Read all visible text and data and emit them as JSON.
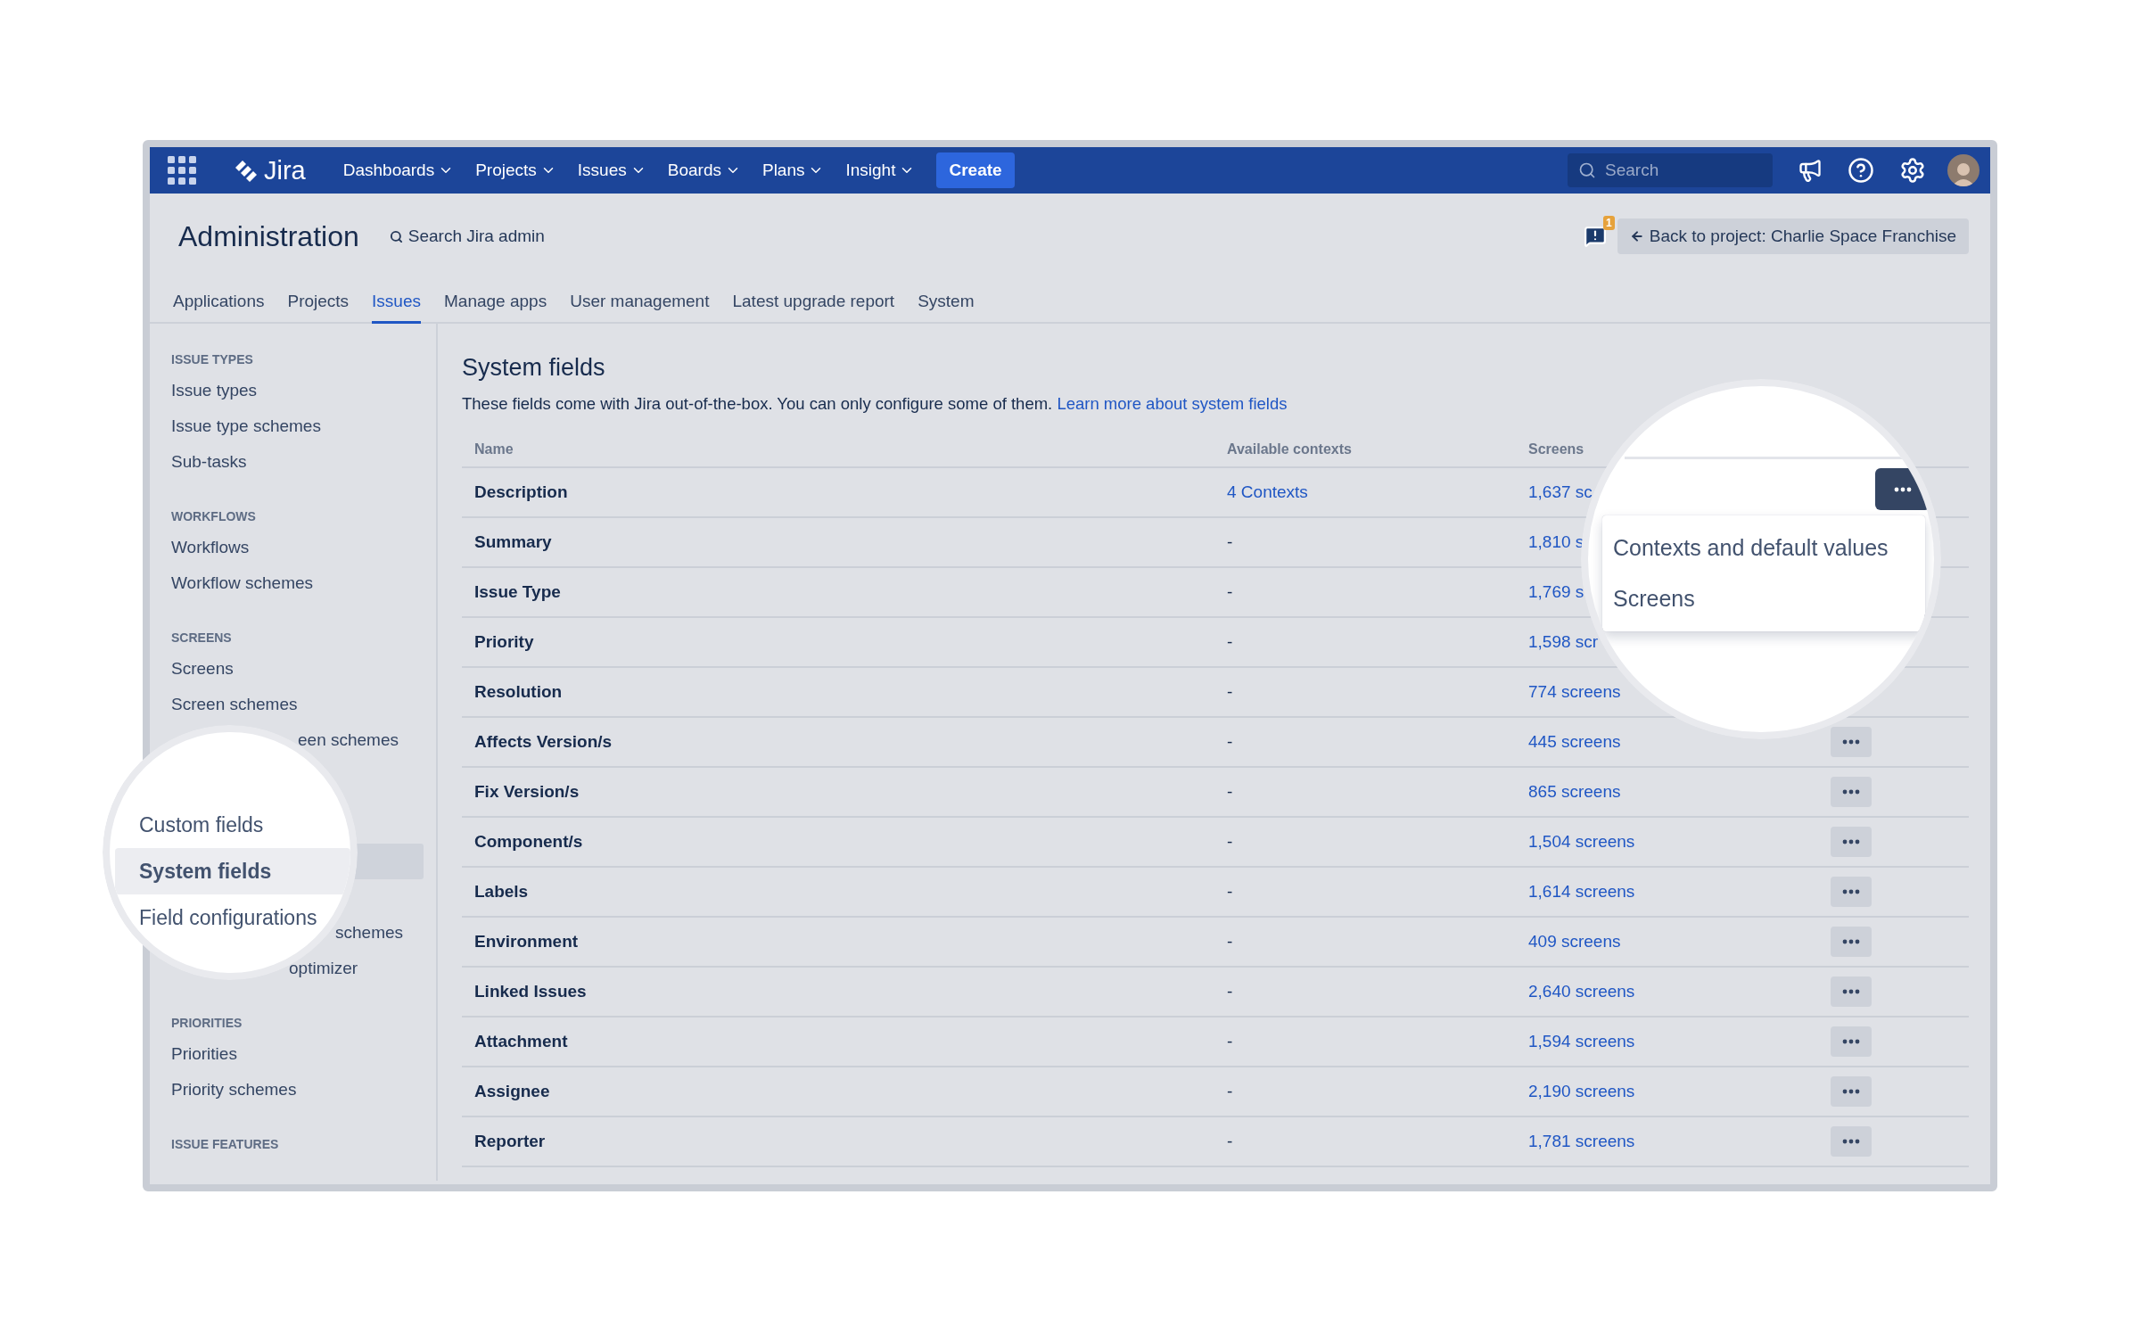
{
  "nav": {
    "logo": "Jira",
    "menus": [
      {
        "label": "Dashboards"
      },
      {
        "label": "Projects"
      },
      {
        "label": "Issues"
      },
      {
        "label": "Boards"
      },
      {
        "label": "Plans"
      },
      {
        "label": "Insight"
      }
    ],
    "create": "Create",
    "search": {
      "placeholder": "Search"
    }
  },
  "header": {
    "title": "Administration",
    "search_link": "Search Jira admin",
    "notification_badge": "1",
    "back_button": "Back to project: Charlie Space Franchise"
  },
  "tabs": [
    {
      "label": "Applications",
      "selected": false
    },
    {
      "label": "Projects",
      "selected": false
    },
    {
      "label": "Issues",
      "selected": true
    },
    {
      "label": "Manage apps",
      "selected": false
    },
    {
      "label": "User management",
      "selected": false
    },
    {
      "label": "Latest upgrade report",
      "selected": false
    },
    {
      "label": "System",
      "selected": false
    }
  ],
  "sidebar": {
    "groups": [
      {
        "kind": "plain",
        "heading": "ISSUE TYPES",
        "items": [
          {
            "label": "Issue types",
            "kind": "full"
          },
          {
            "label": "Issue type schemes",
            "kind": "full"
          },
          {
            "label": "Sub-tasks",
            "kind": "full"
          }
        ]
      },
      {
        "kind": "plain",
        "heading": "WORKFLOWS",
        "items": [
          {
            "label": "Workflows",
            "kind": "full"
          },
          {
            "label": "Workflow schemes",
            "kind": "full"
          }
        ]
      },
      {
        "kind": "plain",
        "heading": "SCREENS",
        "items": [
          {
            "label": "Screens",
            "kind": "full"
          },
          {
            "label": "Screen schemes",
            "kind": "full"
          },
          {
            "label": "een schemes",
            "kind": "partial"
          }
        ]
      },
      {
        "kind": "covered",
        "items": [
          {
            "label": "schemes",
            "kind": "partial"
          },
          {
            "label": "optimizer",
            "kind": "partial"
          }
        ]
      },
      {
        "kind": "plain",
        "heading": "PRIORITIES",
        "items": [
          {
            "label": "Priorities",
            "kind": "full"
          },
          {
            "label": "Priority schemes",
            "kind": "full"
          }
        ]
      },
      {
        "kind": "plain",
        "heading": "ISSUE FEATURES"
      }
    ]
  },
  "content": {
    "title": "System fields",
    "description": "These fields come with Jira out-of-the-box. You can only configure some of them.",
    "learn_more": "Learn more about system fields"
  },
  "table": {
    "columns": [
      "Name",
      "Available contexts",
      "Screens"
    ],
    "rows": [
      {
        "name": "Description",
        "contexts": "4 Contexts",
        "contexts_is_link": true,
        "screens": "1,637 sc",
        "has_menu": false
      },
      {
        "name": "Summary",
        "contexts": "-",
        "contexts_is_link": false,
        "screens": "1,810 s",
        "has_menu": false
      },
      {
        "name": "Issue Type",
        "contexts": "-",
        "contexts_is_link": false,
        "screens": "1,769 s",
        "has_menu": false
      },
      {
        "name": "Priority",
        "contexts": "-",
        "contexts_is_link": false,
        "screens": "1,598 scr",
        "has_menu": false
      },
      {
        "name": "Resolution",
        "contexts": "-",
        "contexts_is_link": false,
        "screens": "774 screens",
        "has_menu": false
      },
      {
        "name": "Affects Version/s",
        "contexts": "-",
        "contexts_is_link": false,
        "screens": "445 screens",
        "has_menu": true
      },
      {
        "name": "Fix Version/s",
        "contexts": "-",
        "contexts_is_link": false,
        "screens": "865 screens",
        "has_menu": true
      },
      {
        "name": "Component/s",
        "contexts": "-",
        "contexts_is_link": false,
        "screens": "1,504 screens",
        "has_menu": true
      },
      {
        "name": "Labels",
        "contexts": "-",
        "contexts_is_link": false,
        "screens": "1,614 screens",
        "has_menu": true
      },
      {
        "name": "Environment",
        "contexts": "-",
        "contexts_is_link": false,
        "screens": "409 screens",
        "has_menu": true
      },
      {
        "name": "Linked Issues",
        "contexts": "-",
        "contexts_is_link": false,
        "screens": "2,640 screens",
        "has_menu": true
      },
      {
        "name": "Attachment",
        "contexts": "-",
        "contexts_is_link": false,
        "screens": "1,594 screens",
        "has_menu": true
      },
      {
        "name": "Assignee",
        "contexts": "-",
        "contexts_is_link": false,
        "screens": "2,190 screens",
        "has_menu": true
      },
      {
        "name": "Reporter",
        "contexts": "-",
        "contexts_is_link": false,
        "screens": "1,781 screens",
        "has_menu": true
      }
    ]
  },
  "magnifier_left": {
    "items": [
      {
        "label": "Custom fields",
        "selected": false
      },
      {
        "label": "System fields",
        "selected": true
      },
      {
        "label": "Field configurations",
        "selected": false
      }
    ]
  },
  "magnifier_right": {
    "button_active": true,
    "menu": [
      "Contexts and default values",
      "Screens"
    ]
  }
}
